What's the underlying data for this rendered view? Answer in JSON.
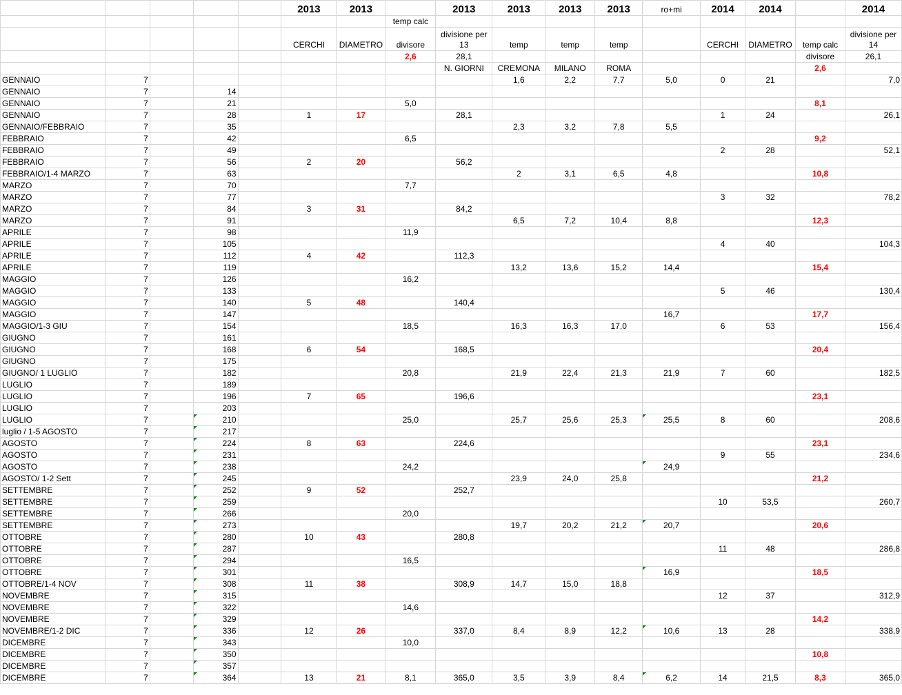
{
  "sheet": {
    "header_rows": [
      [
        "",
        "",
        "",
        "",
        "",
        "2013",
        "2013",
        "",
        "2013",
        "2013",
        "2013",
        "2013",
        "ro+mi",
        "2014",
        "2014",
        "",
        "2014"
      ],
      [
        "",
        "",
        "",
        "",
        "",
        "",
        "",
        "temp calc",
        "",
        "",
        "",
        "",
        "",
        "",
        "",
        "",
        ""
      ],
      [
        "",
        "",
        "",
        "",
        "",
        "CERCHI",
        "DIAMETRO",
        "divisore",
        "divisione per 13",
        "temp",
        "temp",
        "temp",
        "",
        "CERCHI",
        "DIAMETRO",
        "temp calc",
        "divisione per 14"
      ],
      [
        "",
        "",
        "",
        "",
        "",
        "",
        "",
        "2,6",
        "28,1",
        "",
        "",
        "",
        "",
        "",
        "",
        "divisore",
        "26,1"
      ],
      [
        "",
        "",
        "",
        "",
        "",
        "",
        "",
        "",
        "N. GIORNI",
        "CREMONA",
        "MILANO",
        "ROMA",
        "",
        "",
        "",
        "2,6",
        ""
      ]
    ],
    "rows": [
      [
        "GENNAIO",
        "7",
        "",
        "",
        "",
        "",
        "",
        "",
        "",
        "1,6",
        "2,2",
        "7,7",
        "5,0",
        "0",
        "21",
        "",
        "7,0"
      ],
      [
        "GENNAIO",
        "7",
        "",
        "14",
        "",
        "",
        "",
        "",
        "",
        "",
        "",
        "",
        "",
        "",
        "",
        "",
        ""
      ],
      [
        "GENNAIO",
        "7",
        "",
        "21",
        "",
        "",
        "",
        "5,0",
        "",
        "",
        "",
        "",
        "",
        "",
        "",
        "8,1",
        ""
      ],
      [
        "GENNAIO",
        "7",
        "",
        "28",
        "",
        "1",
        "17",
        "",
        "28,1",
        "",
        "",
        "",
        "",
        "1",
        "24",
        "",
        "26,1"
      ],
      [
        "GENNAIO/FEBBRAIO",
        "7",
        "",
        "35",
        "",
        "",
        "",
        "",
        "",
        "2,3",
        "3,2",
        "7,8",
        "5,5",
        "",
        "",
        "",
        ""
      ],
      [
        "FEBBRAIO",
        "7",
        "",
        "42",
        "",
        "",
        "",
        "6,5",
        "",
        "",
        "",
        "",
        "",
        "",
        "",
        "9,2",
        ""
      ],
      [
        "FEBBRAIO",
        "7",
        "",
        "49",
        "",
        "",
        "",
        "",
        "",
        "",
        "",
        "",
        "",
        "2",
        "28",
        "",
        "52,1"
      ],
      [
        "FEBBRAIO",
        "7",
        "",
        "56",
        "",
        "2",
        "20",
        "",
        "56,2",
        "",
        "",
        "",
        "",
        "",
        "",
        "",
        ""
      ],
      [
        "FEBBRAIO/1-4 MARZO",
        "7",
        "",
        "63",
        "",
        "",
        "",
        "",
        "",
        "2",
        "3,1",
        "6,5",
        "4,8",
        "",
        "",
        "10,8",
        ""
      ],
      [
        "MARZO",
        "7",
        "",
        "70",
        "",
        "",
        "",
        "7,7",
        "",
        "",
        "",
        "",
        "",
        "",
        "",
        "",
        ""
      ],
      [
        "MARZO",
        "7",
        "",
        "77",
        "",
        "",
        "",
        "",
        "",
        "",
        "",
        "",
        "",
        "3",
        "32",
        "",
        "78,2"
      ],
      [
        "MARZO",
        "7",
        "",
        "84",
        "",
        "3",
        "31",
        "",
        "84,2",
        "",
        "",
        "",
        "",
        "",
        "",
        "",
        ""
      ],
      [
        "MARZO",
        "7",
        "",
        "91",
        "",
        "",
        "",
        "",
        "",
        "6,5",
        "7,2",
        "10,4",
        "8,8",
        "",
        "",
        "12,3",
        ""
      ],
      [
        "APRILE",
        "7",
        "",
        "98",
        "",
        "",
        "",
        "11,9",
        "",
        "",
        "",
        "",
        "",
        "",
        "",
        "",
        ""
      ],
      [
        "APRILE",
        "7",
        "",
        "105",
        "",
        "",
        "",
        "",
        "",
        "",
        "",
        "",
        "",
        "4",
        "40",
        "",
        "104,3"
      ],
      [
        "APRILE",
        "7",
        "",
        "112",
        "",
        "4",
        "42",
        "",
        "112,3",
        "",
        "",
        "",
        "",
        "",
        "",
        "",
        ""
      ],
      [
        "APRILE",
        "7",
        "",
        "119",
        "",
        "",
        "",
        "",
        "",
        "13,2",
        "13,6",
        "15,2",
        "14,4",
        "",
        "",
        "15,4",
        ""
      ],
      [
        "MAGGIO",
        "7",
        "",
        "126",
        "",
        "",
        "",
        "16,2",
        "",
        "",
        "",
        "",
        "",
        "",
        "",
        "",
        ""
      ],
      [
        "MAGGIO",
        "7",
        "",
        "133",
        "",
        "",
        "",
        "",
        "",
        "",
        "",
        "",
        "",
        "5",
        "46",
        "",
        "130,4"
      ],
      [
        "MAGGIO",
        "7",
        "",
        "140",
        "",
        "5",
        "48",
        "",
        "140,4",
        "",
        "",
        "",
        "",
        "",
        "",
        "",
        ""
      ],
      [
        "MAGGIO",
        "7",
        "",
        "147",
        "",
        "",
        "",
        "",
        "",
        "",
        "",
        "",
        "16,7",
        "",
        "",
        "17,7",
        ""
      ],
      [
        "MAGGIO/1-3 GIU",
        "7",
        "",
        "154",
        "",
        "",
        "",
        "18,5",
        "",
        "16,3",
        "16,3",
        "17,0",
        "",
        "6",
        "53",
        "",
        "156,4"
      ],
      [
        "GIUGNO",
        "7",
        "",
        "161",
        "",
        "",
        "",
        "",
        "",
        "",
        "",
        "",
        "",
        "",
        "",
        "",
        ""
      ],
      [
        "GIUGNO",
        "7",
        "",
        "168",
        "",
        "6",
        "54",
        "",
        "168,5",
        "",
        "",
        "",
        "",
        "",
        "",
        "20,4",
        ""
      ],
      [
        "GIUGNO",
        "7",
        "",
        "175",
        "",
        "",
        "",
        "",
        "",
        "",
        "",
        "",
        "",
        "",
        "",
        "",
        ""
      ],
      [
        "GIUGNO/ 1 LUGLIO",
        "7",
        "",
        "182",
        "",
        "",
        "",
        "20,8",
        "",
        "21,9",
        "22,4",
        "21,3",
        "21,9",
        "7",
        "60",
        "",
        "182,5"
      ],
      [
        "LUGLIO",
        "7",
        "",
        "189",
        "",
        "",
        "",
        "",
        "",
        "",
        "",
        "",
        "",
        "",
        "",
        "",
        ""
      ],
      [
        "LUGLIO",
        "7",
        "",
        "196",
        "",
        "7",
        "65",
        "",
        "196,6",
        "",
        "",
        "",
        "",
        "",
        "",
        "23,1",
        ""
      ],
      [
        "LUGLIO",
        "7",
        "",
        "203",
        "",
        "",
        "",
        "",
        "",
        "",
        "",
        "",
        "",
        "",
        "",
        "",
        ""
      ],
      [
        "LUGLIO",
        "7",
        "",
        "210",
        "",
        "",
        "",
        "25,0",
        "",
        "25,7",
        "25,6",
        "25,3",
        "25,5",
        "8",
        "60",
        "",
        "208,6"
      ],
      [
        "luglio / 1-5 AGOSTO",
        "7",
        "",
        "217",
        "",
        "",
        "",
        "",
        "",
        "",
        "",
        "",
        "",
        "",
        "",
        "",
        ""
      ],
      [
        "AGOSTO",
        "7",
        "",
        "224",
        "",
        "8",
        "63",
        "",
        "224,6",
        "",
        "",
        "",
        "",
        "",
        "",
        "23,1",
        ""
      ],
      [
        "AGOSTO",
        "7",
        "",
        "231",
        "",
        "",
        "",
        "",
        "",
        "",
        "",
        "",
        "",
        "9",
        "55",
        "",
        "234,6"
      ],
      [
        "AGOSTO",
        "7",
        "",
        "238",
        "",
        "",
        "",
        "24,2",
        "",
        "",
        "",
        "",
        "24,9",
        "",
        "",
        "",
        ""
      ],
      [
        "AGOSTO/ 1-2 Sett",
        "7",
        "",
        "245",
        "",
        "",
        "",
        "",
        "",
        "23,9",
        "24,0",
        "25,8",
        "",
        "",
        "",
        "21,2",
        ""
      ],
      [
        "SETTEMBRE",
        "7",
        "",
        "252",
        "",
        "9",
        "52",
        "",
        "252,7",
        "",
        "",
        "",
        "",
        "",
        "",
        "",
        ""
      ],
      [
        "SETTEMBRE",
        "7",
        "",
        "259",
        "",
        "",
        "",
        "",
        "",
        "",
        "",
        "",
        "",
        "10",
        "53,5",
        "",
        "260,7"
      ],
      [
        "SETTEMBRE",
        "7",
        "",
        "266",
        "",
        "",
        "",
        "20,0",
        "",
        "",
        "",
        "",
        "",
        "",
        "",
        "",
        ""
      ],
      [
        "SETTEMBRE",
        "7",
        "",
        "273",
        "",
        "",
        "",
        "",
        "",
        "19,7",
        "20,2",
        "21,2",
        "20,7",
        "",
        "",
        "20,6",
        ""
      ],
      [
        "OTTOBRE",
        "7",
        "",
        "280",
        "",
        "10",
        "43",
        "",
        "280,8",
        "",
        "",
        "",
        "",
        "",
        "",
        "",
        ""
      ],
      [
        "OTTOBRE",
        "7",
        "",
        "287",
        "",
        "",
        "",
        "",
        "",
        "",
        "",
        "",
        "",
        "11",
        "48",
        "",
        "286,8"
      ],
      [
        "OTTOBRE",
        "7",
        "",
        "294",
        "",
        "",
        "",
        "16,5",
        "",
        "",
        "",
        "",
        "",
        "",
        "",
        "",
        ""
      ],
      [
        "OTTOBRE",
        "7",
        "",
        "301",
        "",
        "",
        "",
        "",
        "",
        "",
        "",
        "",
        "16,9",
        "",
        "",
        "18,5",
        ""
      ],
      [
        "OTTOBRE/1-4 NOV",
        "7",
        "",
        "308",
        "",
        "11",
        "38",
        "",
        "308,9",
        "14,7",
        "15,0",
        "18,8",
        "",
        "",
        "",
        "",
        ""
      ],
      [
        "NOVEMBRE",
        "7",
        "",
        "315",
        "",
        "",
        "",
        "",
        "",
        "",
        "",
        "",
        "",
        "12",
        "37",
        "",
        "312,9"
      ],
      [
        "NOVEMBRE",
        "7",
        "",
        "322",
        "",
        "",
        "",
        "14,6",
        "",
        "",
        "",
        "",
        "",
        "",
        "",
        "",
        ""
      ],
      [
        "NOVEMBRE",
        "7",
        "",
        "329",
        "",
        "",
        "",
        "",
        "",
        "",
        "",
        "",
        "",
        "",
        "",
        "14,2",
        ""
      ],
      [
        "NOVEMBRE/1-2 DIC",
        "7",
        "",
        "336",
        "",
        "12",
        "26",
        "",
        "337,0",
        "8,4",
        "8,9",
        "12,2",
        "10,6",
        "13",
        "28",
        "",
        "338,9"
      ],
      [
        "DICEMBRE",
        "7",
        "",
        "343",
        "",
        "",
        "",
        "10,0",
        "",
        "",
        "",
        "",
        "",
        "",
        "",
        "",
        ""
      ],
      [
        "DICEMBRE",
        "7",
        "",
        "350",
        "",
        "",
        "",
        "",
        "",
        "",
        "",
        "",
        "",
        "",
        "",
        "10,8",
        ""
      ],
      [
        "DICEMBRE",
        "7",
        "",
        "357",
        "",
        "",
        "",
        "",
        "",
        "",
        "",
        "",
        "",
        "",
        "",
        "",
        ""
      ],
      [
        "DICEMBRE",
        "7",
        "",
        "364",
        "",
        "13",
        "21",
        "8,1",
        "365,0",
        "3,5",
        "3,9",
        "8,4",
        "6,2",
        "14",
        "21,5",
        "8,3",
        "365,0"
      ]
    ]
  }
}
